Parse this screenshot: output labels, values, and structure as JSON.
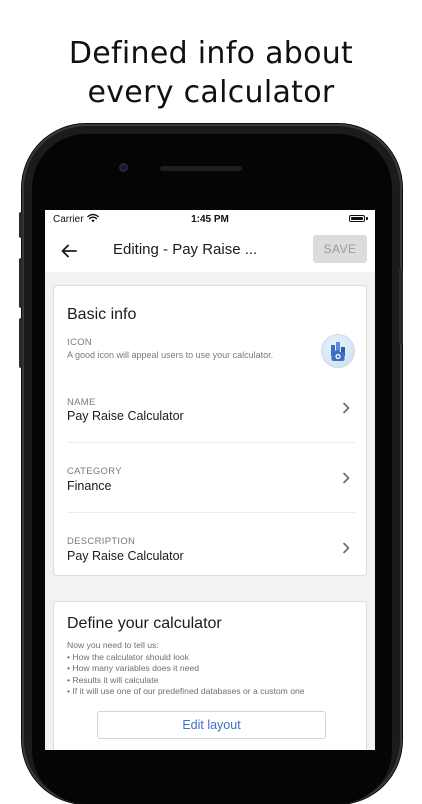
{
  "headline": {
    "line1": "Defined info about",
    "line2": "every calculator"
  },
  "status_bar": {
    "carrier": "Carrier",
    "time": "1:45 PM",
    "wifi_icon": "wifi-icon",
    "battery_icon": "battery-full-icon"
  },
  "app_bar": {
    "back_icon": "arrow-left-icon",
    "title": "Editing - Pay Raise ...",
    "save_label": "SAVE"
  },
  "basic_info": {
    "title": "Basic info",
    "icon_field": {
      "label": "ICON",
      "hint": "A good icon will appeal users to use your calculator.",
      "icon": "calculator-chart-camera-icon"
    },
    "fields": [
      {
        "label": "NAME",
        "value": "Pay Raise Calculator"
      },
      {
        "label": "CATEGORY",
        "value": "Finance"
      },
      {
        "label": "DESCRIPTION",
        "value": "Pay Raise Calculator"
      }
    ]
  },
  "define": {
    "title": "Define your calculator",
    "intro": "Now you need to tell us:",
    "bullets": [
      "• How the calculator should look",
      "• How many variables does it need",
      "• Results it will calculate",
      "• If it will use one of our predefined databases or a custom one"
    ],
    "edit_label": "Edit layout"
  },
  "colors": {
    "accent": "#3d6fc4",
    "screen_bg": "#f2f2f2",
    "phone_frame": "#1b1b1d"
  }
}
